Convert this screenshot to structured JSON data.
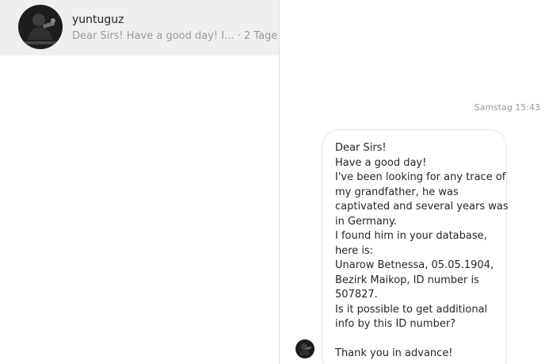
{
  "sidebar": {
    "thread": {
      "username": "yuntuguz",
      "preview": "Dear Sirs! Have a good day! I...",
      "age": "2 Tage"
    }
  },
  "chat": {
    "timestamp": "Samstag 15:43",
    "message_lines": [
      "Dear Sirs!",
      "Have a good day!",
      "I've been looking for any trace of",
      "my grandfather, he was",
      "captivated and several years was",
      "in Germany.",
      "I found him in your database,",
      "here is:",
      "Unarow Betnessa, 05.05.1904,",
      "Bezirk Maikop, ID number is",
      "507827.",
      "Is it possible to get additional",
      "info by this ID number?",
      "",
      "Thank you in advance!"
    ]
  },
  "colors": {
    "selected_thread_bg": "#efefef",
    "text_primary": "#262626",
    "text_secondary": "#999999",
    "bubble_border": "#e6e6e6",
    "divider": "#dbdbdb"
  },
  "icons": {
    "thread_avatar": "profile-photo-icon",
    "message_avatar": "profile-photo-icon"
  }
}
